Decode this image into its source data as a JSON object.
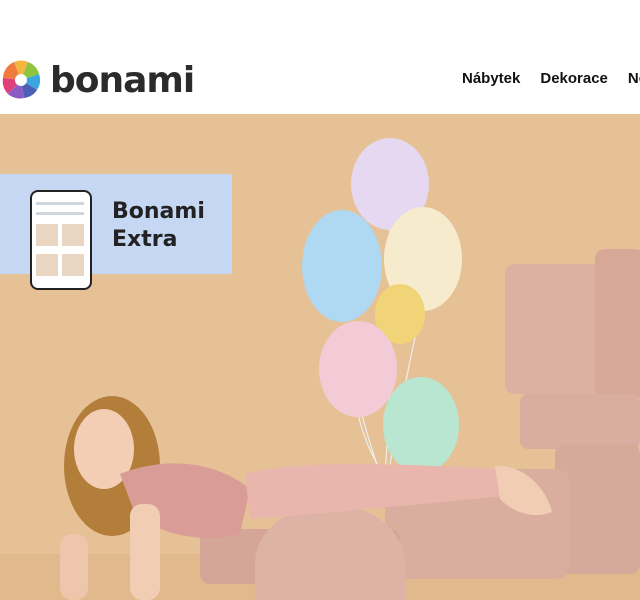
{
  "header": {
    "logo_text": "bonami",
    "nav": [
      "Nábytek",
      "Dekorace",
      "Nov"
    ]
  },
  "hero": {
    "promo": {
      "title_line1": "Bonami",
      "title_line2": "Extra"
    }
  },
  "colors": {
    "hero_bg": "#e7c196",
    "promo_bg": "#c6d7f3",
    "brand_text": "#2b2b2b"
  }
}
